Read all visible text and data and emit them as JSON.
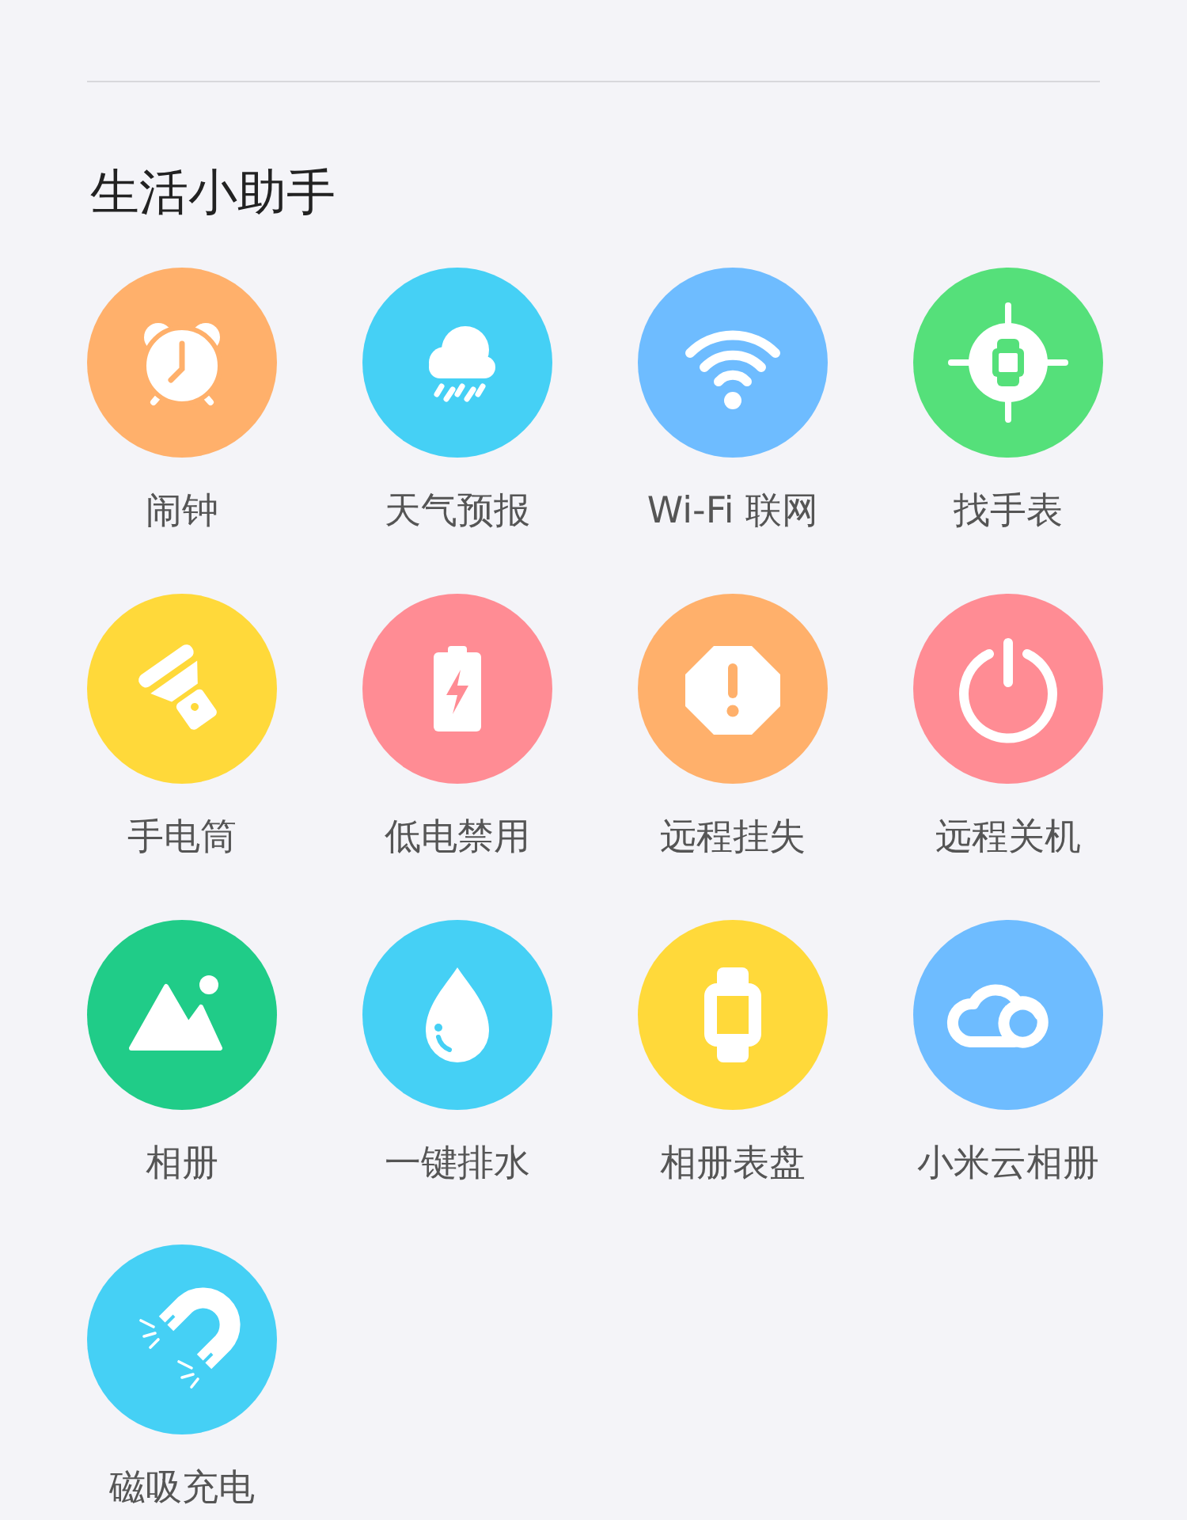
{
  "section": {
    "title": "生活小助手"
  },
  "items": [
    {
      "label": "闹钟",
      "color": "#ffb06b"
    },
    {
      "label": "天气预报",
      "color": "#45d0f5"
    },
    {
      "label": "Wi-Fi 联网",
      "color": "#6ebcff"
    },
    {
      "label": "找手表",
      "color": "#55e07a"
    },
    {
      "label": "手电筒",
      "color": "#ffd93a"
    },
    {
      "label": "低电禁用",
      "color": "#ff8c94"
    },
    {
      "label": "远程挂失",
      "color": "#ffb06b"
    },
    {
      "label": "远程关机",
      "color": "#ff8c94"
    },
    {
      "label": "相册",
      "color": "#20cc88"
    },
    {
      "label": "一键排水",
      "color": "#45d0f5"
    },
    {
      "label": "相册表盘",
      "color": "#ffd93a"
    },
    {
      "label": "小米云相册",
      "color": "#6ebcff"
    },
    {
      "label": "磁吸充电",
      "color": "#45d0f5"
    }
  ]
}
